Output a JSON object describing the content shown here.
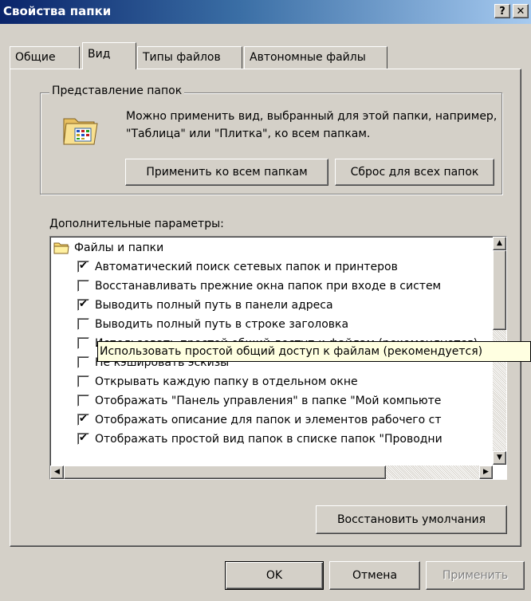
{
  "window": {
    "title": "Свойства папки",
    "help_button": "?",
    "close_button": "✕"
  },
  "tabs": [
    {
      "label": "Общие",
      "active": false
    },
    {
      "label": "Вид",
      "active": true
    },
    {
      "label": "Типы файлов",
      "active": false
    },
    {
      "label": "Автономные файлы",
      "active": false
    }
  ],
  "folder_views": {
    "legend": "Представление папок",
    "description": "Можно применить вид, выбранный для этой папки, например, \"Таблица\" или \"Плитка\", ко всем папкам.",
    "apply_all_label": "Применить ко всем папкам",
    "reset_all_label": "Сброс для всех папок"
  },
  "advanced": {
    "label": "Дополнительные параметры:",
    "group_label": "Файлы и папки",
    "items": [
      {
        "text": "Автоматический поиск сетевых папок и принтеров",
        "checked": true
      },
      {
        "text": "Восстанавливать прежние окна папок при входе в систем",
        "checked": false
      },
      {
        "text": "Выводить полный путь в панели адреса",
        "checked": true
      },
      {
        "text": "Выводить полный путь в строке заголовка",
        "checked": false
      },
      {
        "text": "Использовать простой общий доступ к файлам (рекомендуется)",
        "checked": false
      },
      {
        "text": "Не кэшировать эскизы",
        "checked": false
      },
      {
        "text": "Открывать каждую папку в отдельном окне",
        "checked": false
      },
      {
        "text": "Отображать \"Панель управления\" в папке \"Мой компьюте",
        "checked": false
      },
      {
        "text": "Отображать описание для папок и элементов рабочего ст",
        "checked": true
      },
      {
        "text": "Отображать простой вид папок в списке папок \"Проводни",
        "checked": true
      }
    ],
    "tooltip": "Использовать простой общий доступ к файлам (рекомендуется)"
  },
  "restore_defaults_label": "Восстановить умолчания",
  "footer": {
    "ok_label": "OK",
    "cancel_label": "Отмена",
    "apply_label": "Применить"
  },
  "colors": {
    "title_start": "#0a246a",
    "title_end": "#a6caf0",
    "face": "#d4d0c8",
    "tooltip_bg": "#ffffe1"
  }
}
